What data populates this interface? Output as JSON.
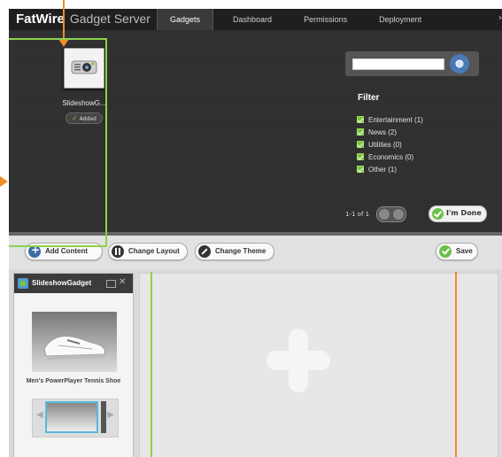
{
  "app": {
    "brand": "FatWire",
    "product": "Gadget Server"
  },
  "nav": {
    "tabs": [
      "Gadgets",
      "Dashboard",
      "Permissions",
      "Deployment"
    ],
    "active": "Gadgets",
    "overflow_symbol": "›"
  },
  "gallery": {
    "gadget_name": "SlideshowG...",
    "gadget_status": "Added",
    "search": {
      "value": "",
      "placeholder": ""
    },
    "filter_title": "Filter",
    "filters": [
      "Entertainment (1)",
      "News (2)",
      "Utilities (0)",
      "Economics (0)",
      "Other (1)"
    ],
    "pager_text": "1-1 of 1",
    "done_label": "I'm Done"
  },
  "toolbar": {
    "add_content": "Add Content",
    "change_layout": "Change Layout",
    "change_theme": "Change Theme",
    "save": "Save"
  },
  "gadget_window": {
    "title": "SlideshowGadget",
    "product_name": "Men's PowerPlayer Tennis Shoe"
  },
  "colors": {
    "annotation_orange": "#ef8c26",
    "annotation_green": "#8cd14d",
    "check_green": "#7cc241"
  }
}
